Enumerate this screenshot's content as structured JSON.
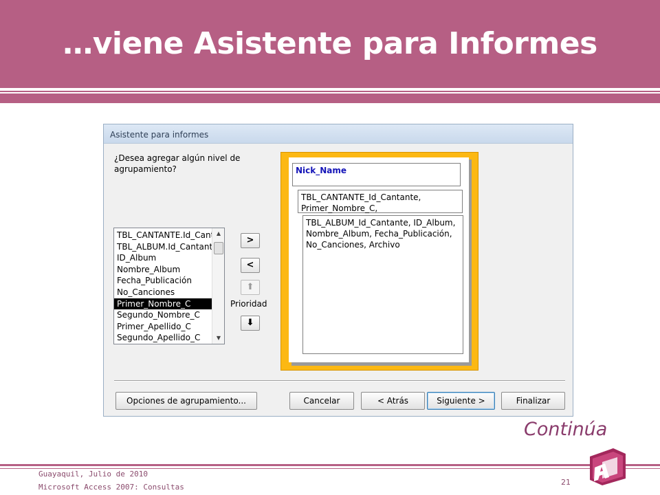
{
  "slide": {
    "title": "…viene Asistente para Informes",
    "continue_label": "Continúa",
    "footer_line1": "Guayaquil, Julio de 2010",
    "footer_line2": "Microsoft Access 2007: Consultas",
    "page_number": "21",
    "logo_icon": "access-logo-icon",
    "accent_color": "#b65f84"
  },
  "dialog": {
    "title": "Asistente para informes",
    "question": "¿Desea agregar algún nivel de agrupamiento?",
    "fields": [
      "TBL_CANTANTE.Id_Cantante",
      "TBL_ALBUM.Id_Cantante",
      "ID_Album",
      "Nombre_Album",
      "Fecha_Publicación",
      "No_Canciones",
      "Primer_Nombre_C",
      "Segundo_Nombre_C",
      "Primer_Apellido_C",
      "Segundo_Apellido_C"
    ],
    "selected_field": "Primer_Nombre_C",
    "add_button": ">",
    "remove_button": "<",
    "priority_up_icon": "arrow-up-icon",
    "priority_label": "Prioridad",
    "priority_down_icon": "arrow-down-icon",
    "preview": {
      "level1": "Nick_Name",
      "level2": "TBL_CANTANTE_Id_Cantante, Primer_Nombre_C,",
      "detail": "TBL_ALBUM_Id_Cantante, ID_Album, Nombre_Album, Fecha_Publicación, No_Canciones, Archivo"
    },
    "buttons": {
      "grouping_options": "Opciones de agrupamiento...",
      "cancel": "Cancelar",
      "back": "< Atrás",
      "next": "Siguiente >",
      "finish": "Finalizar"
    }
  }
}
